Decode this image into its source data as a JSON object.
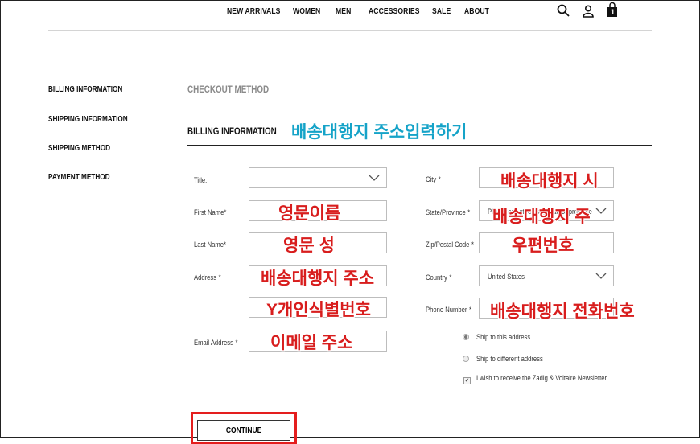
{
  "nav": {
    "items": [
      "NEW ARRIVALS",
      "WOMEN",
      "MEN",
      "ACCESSORIES",
      "SALE",
      "ABOUT"
    ],
    "icons": [
      "search-icon",
      "user-icon",
      "shopping-bag-icon"
    ],
    "cart_count": "1"
  },
  "sidebar": {
    "items": [
      "BILLING INFORMATION",
      "SHIPPING INFORMATION",
      "SHIPPING METHOD",
      "PAYMENT METHOD"
    ]
  },
  "checkout_method": "CHECKOUT METHOD",
  "billing_title": "BILLING INFORMATION",
  "billing_note": "배송대행지 주소입력하기",
  "form": {
    "title_label": "Title:",
    "first_name_label": "First Name",
    "last_name_label": "Last Name",
    "address_label": "Address",
    "email_label": "Email Address",
    "city_label": "City",
    "state_label": "State/Province",
    "zip_label": "Zip/Postal Code",
    "country_label": "Country",
    "phone_label": "Phone Number",
    "required_mark": "*",
    "country_value": "United States",
    "state_placeholder": "Please select region, state or province"
  },
  "annotations": {
    "first_name": "영문이름",
    "last_name": "영문 성",
    "address": "배송대행지 주소",
    "address2": "Y개인식별번호",
    "email": "이메일 주소",
    "city": "배송대행지 시",
    "state": "배송대행지 주",
    "zip": "우편번호",
    "phone": "배송대행지 전화번호"
  },
  "options": {
    "ship_to_this": "Ship to this address",
    "ship_to_different": "Ship to different address",
    "newsletter": "I wish to receive the Zadig & Voltaire Newsletter."
  },
  "continue_label": "CONTINUE",
  "colors": {
    "annotation_blue": "#15a3c8",
    "annotation_red": "#d81d1d",
    "highlight_box": "#e41e1e"
  }
}
